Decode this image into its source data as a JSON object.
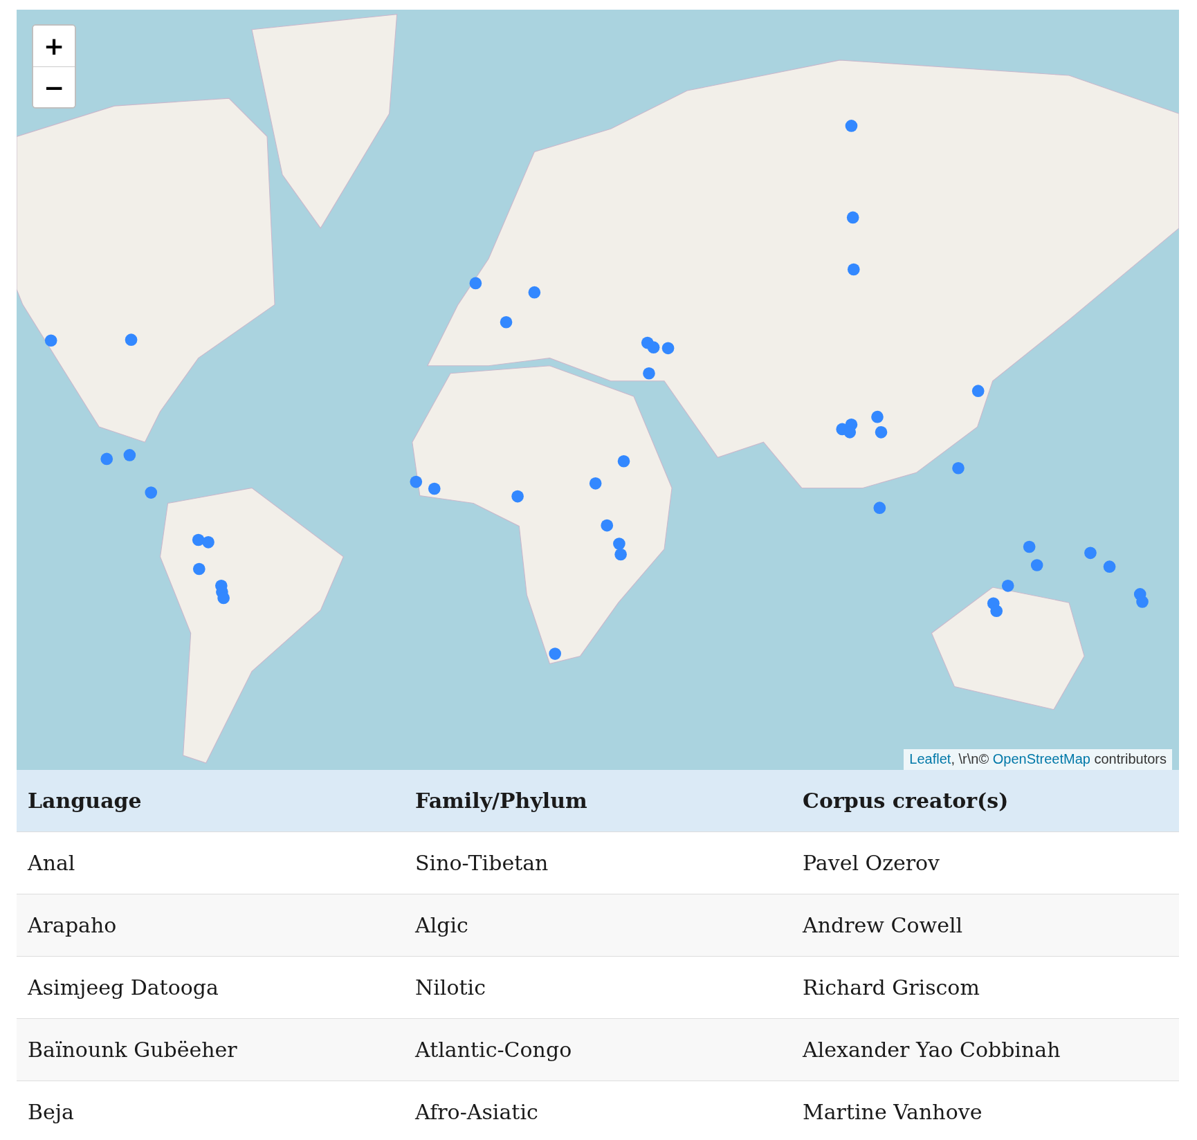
{
  "map": {
    "zoom_controls": [
      "+",
      "−"
    ],
    "attribution": [
      {
        "kind": "link",
        "text": "Leaflet"
      },
      {
        "kind": "text",
        "text": ", \\r\\n© "
      },
      {
        "kind": "link",
        "text": "OpenStreetMap"
      },
      {
        "kind": "text",
        "text": " contributors"
      }
    ]
  },
  "table": {
    "columns": [
      "Language",
      "Family/Phylum",
      "Corpus creator(s)"
    ],
    "rows": [
      [
        "Anal",
        "Sino-Tibetan",
        "Pavel Ozerov"
      ],
      [
        "Arapaho",
        "Algic",
        "Andrew Cowell"
      ],
      [
        "Asimjeeg Datooga",
        "Nilotic",
        "Richard Griscom"
      ],
      [
        "Baïnounk Gubëeher",
        "Atlantic-Congo",
        "Alexander Yao Cobbinah"
      ],
      [
        "Beja",
        "Afro-Asiatic",
        "Martine Vanhove"
      ]
    ]
  }
}
